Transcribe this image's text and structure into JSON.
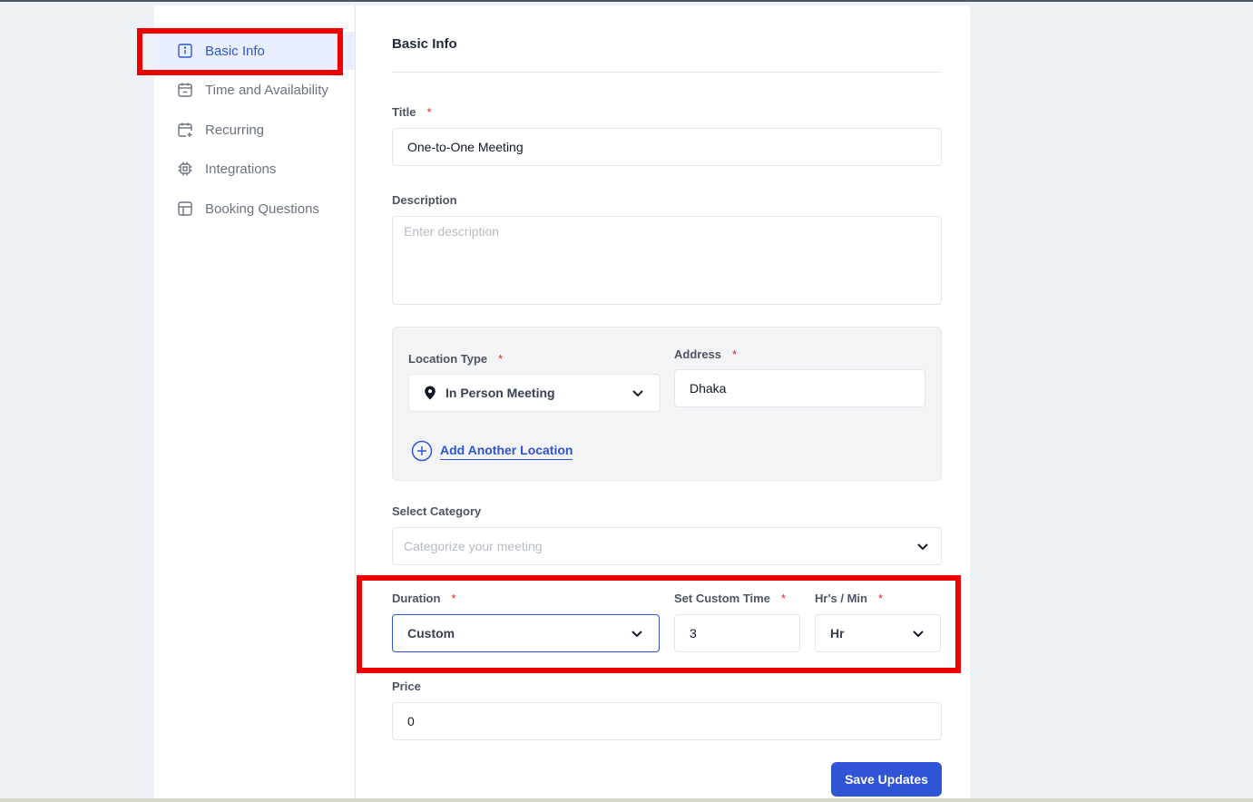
{
  "sidebar": {
    "items": [
      {
        "label": "Basic Info",
        "icon": "info-icon"
      },
      {
        "label": "Time and Availability",
        "icon": "calendar-icon"
      },
      {
        "label": "Recurring",
        "icon": "calendar-plus-icon"
      },
      {
        "label": "Integrations",
        "icon": "chip-icon"
      },
      {
        "label": "Booking Questions",
        "icon": "layout-icon"
      }
    ],
    "active_color": "#2f54d6"
  },
  "main": {
    "section_title": "Basic Info",
    "title_field": {
      "label": "Title",
      "required": "*",
      "value": "One-to-One Meeting"
    },
    "description_field": {
      "label": "Description",
      "placeholder": "Enter description"
    },
    "location": {
      "type_label": "Location Type",
      "type_required": "*",
      "type_value": "In Person Meeting",
      "address_label": "Address",
      "address_required": "*",
      "address_value": "Dhaka",
      "add_another": "Add Another Location"
    },
    "category": {
      "label": "Select Category",
      "placeholder": "Categorize your meeting"
    },
    "duration": {
      "label": "Duration",
      "required": "*",
      "value": "Custom",
      "custom_time_label": "Set Custom Time",
      "custom_time_required": "*",
      "custom_time_value": "3",
      "unit_label": "Hr's / Min",
      "unit_required": "*",
      "unit_value": "Hr"
    },
    "price": {
      "label": "Price",
      "value": "0"
    },
    "save_button": "Save Updates"
  },
  "colors": {
    "accent": "#2f54d6",
    "required": "#dc2626",
    "highlight": "#ef0000"
  }
}
